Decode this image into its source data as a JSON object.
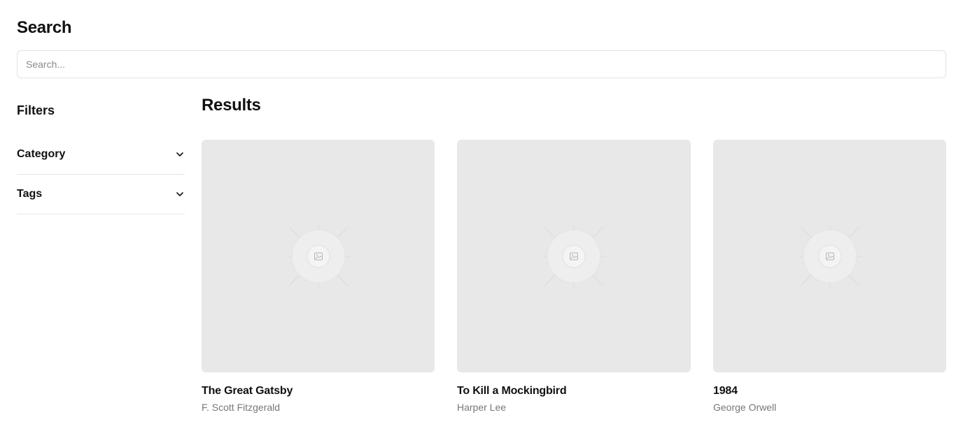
{
  "header": {
    "title": "Search"
  },
  "search": {
    "placeholder": "Search...",
    "value": ""
  },
  "sidebar": {
    "heading": "Filters",
    "filters": [
      {
        "label": "Category",
        "icon": "chevron-down-icon"
      },
      {
        "label": "Tags",
        "icon": "chevron-down-icon"
      }
    ]
  },
  "results": {
    "heading": "Results",
    "items": [
      {
        "title": "The Great Gatsby",
        "author": "F. Scott Fitzgerald",
        "image_icon": "image-placeholder-icon"
      },
      {
        "title": "To Kill a Mockingbird",
        "author": "Harper Lee",
        "image_icon": "image-placeholder-icon"
      },
      {
        "title": "1984",
        "author": "George Orwell",
        "image_icon": "image-placeholder-icon"
      }
    ]
  },
  "colors": {
    "placeholder_bg": "#e8e8e8",
    "border": "#e5e5e5",
    "muted_text": "#777777"
  }
}
